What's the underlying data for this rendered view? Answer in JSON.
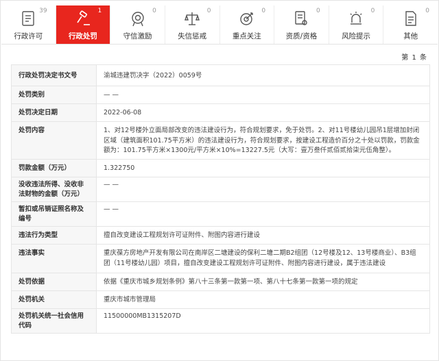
{
  "tabs": [
    {
      "label": "行政许可",
      "count": "39",
      "icon": "document-list-icon"
    },
    {
      "label": "行政处罚",
      "count": "1",
      "icon": "gavel-icon",
      "active": true
    },
    {
      "label": "守信激励",
      "count": "0",
      "icon": "medal-icon"
    },
    {
      "label": "失信惩戒",
      "count": "0",
      "icon": "scales-icon"
    },
    {
      "label": "重点关注",
      "count": "0",
      "icon": "target-icon"
    },
    {
      "label": "资质/资格",
      "count": "0",
      "icon": "certificate-icon"
    },
    {
      "label": "风险提示",
      "count": "0",
      "icon": "alarm-icon"
    },
    {
      "label": "其他",
      "count": "0",
      "icon": "document-icon"
    }
  ],
  "pager": {
    "text": "第 1 条"
  },
  "colors": {
    "accent": "#e8261e"
  },
  "detail_rows": [
    {
      "key": "行政处罚决定书文号",
      "value": "渝城违建罚决字（2022）0059号"
    },
    {
      "key": "处罚类别",
      "value": "— —"
    },
    {
      "key": "处罚决定日期",
      "value": "2022-06-08"
    },
    {
      "key": "处罚内容",
      "value": "1、对12号楼外立面局部改变的违法建设行为，符合规划要求，免于处罚。2、对11号楼幼儿园吊1层增加封闭区域（建筑面积101.75平方米）的违法建设行为，符合规划要求，按建设工程造价百分之十处以罚款，罚款金额为：101.75平方米×1300元/平方米×10%=13227.5元（大写：壹万叁仟贰佰贰拾柒元伍角整）。"
    },
    {
      "key": "罚款金额（万元）",
      "value": "1.322750"
    },
    {
      "key": "没收违法所得、没收非法财物的金额（万元）",
      "value": "— —"
    },
    {
      "key": "暂扣或吊销证照名称及编号",
      "value": "— —"
    },
    {
      "key": "违法行为类型",
      "value": "擅自改变建设工程规划许可证附件、附图内容进行建设"
    },
    {
      "key": "违法事实",
      "value": "重庆葆方房地产开发有限公司在南岸区二塘建设的保利二塘二期B2组团（12号楼及12、13号楼商业）、B3组团（11号楼幼儿园）项目，擅自改变建设工程规划许可证附件、附图内容进行建设，属于违法建设"
    },
    {
      "key": "处罚依据",
      "value": "依据《重庆市城乡规划条例》第八十三条第一款第一项、第八十七条第一款第一项的规定"
    },
    {
      "key": "处罚机关",
      "value": "重庆市城市管理局"
    },
    {
      "key": "处罚机关统一社会信用代码",
      "value": "11500000MB1315207D"
    }
  ]
}
